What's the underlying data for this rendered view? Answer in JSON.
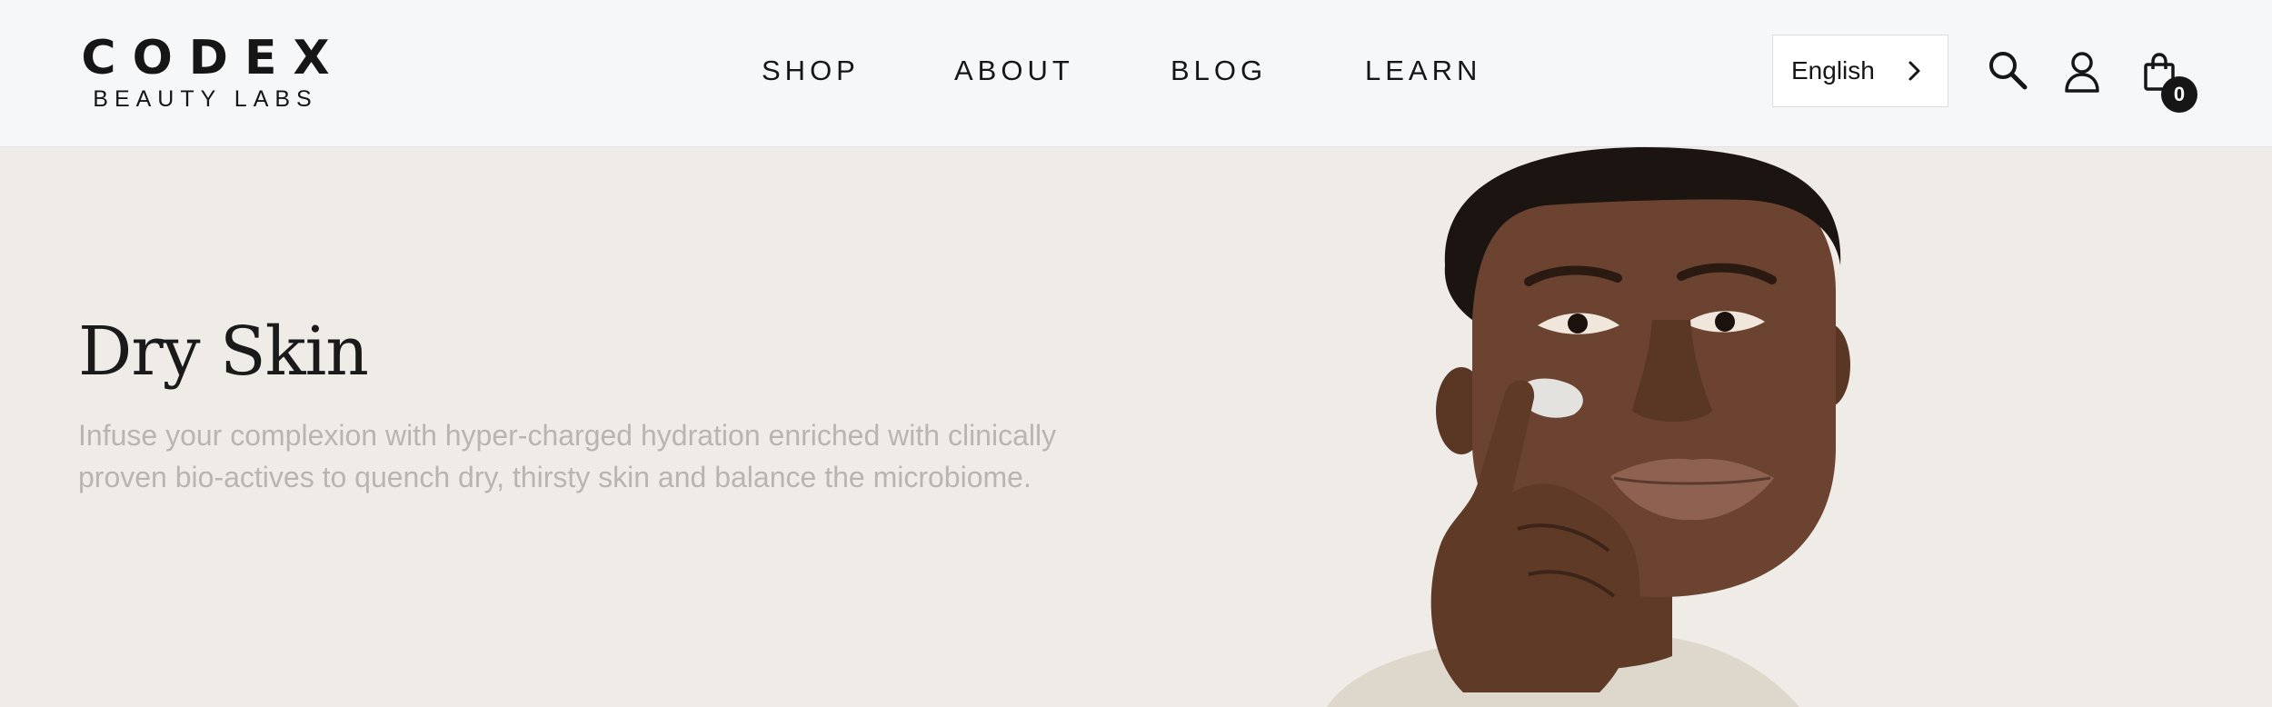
{
  "brand": {
    "name": "CODEX",
    "tagline": "BEAUTY LABS"
  },
  "nav": {
    "items": [
      {
        "label": "SHOP"
      },
      {
        "label": "ABOUT"
      },
      {
        "label": "BLOG"
      },
      {
        "label": "LEARN"
      }
    ]
  },
  "header": {
    "language": "English",
    "cart_count": "0",
    "icons": [
      "search-icon",
      "account-icon",
      "shopping-bag-icon",
      "chevron-right-icon"
    ]
  },
  "hero": {
    "title": "Dry Skin",
    "description": "Infuse your complexion with hyper-charged hydration enriched with clinically proven bio-actives to quench dry, thirsty skin and balance the microbiome."
  },
  "colors": {
    "header_bg": "#f6f7f9",
    "hero_bg": "#efebe7",
    "text_dark": "#161616",
    "text_muted": "#b8b5b1"
  }
}
